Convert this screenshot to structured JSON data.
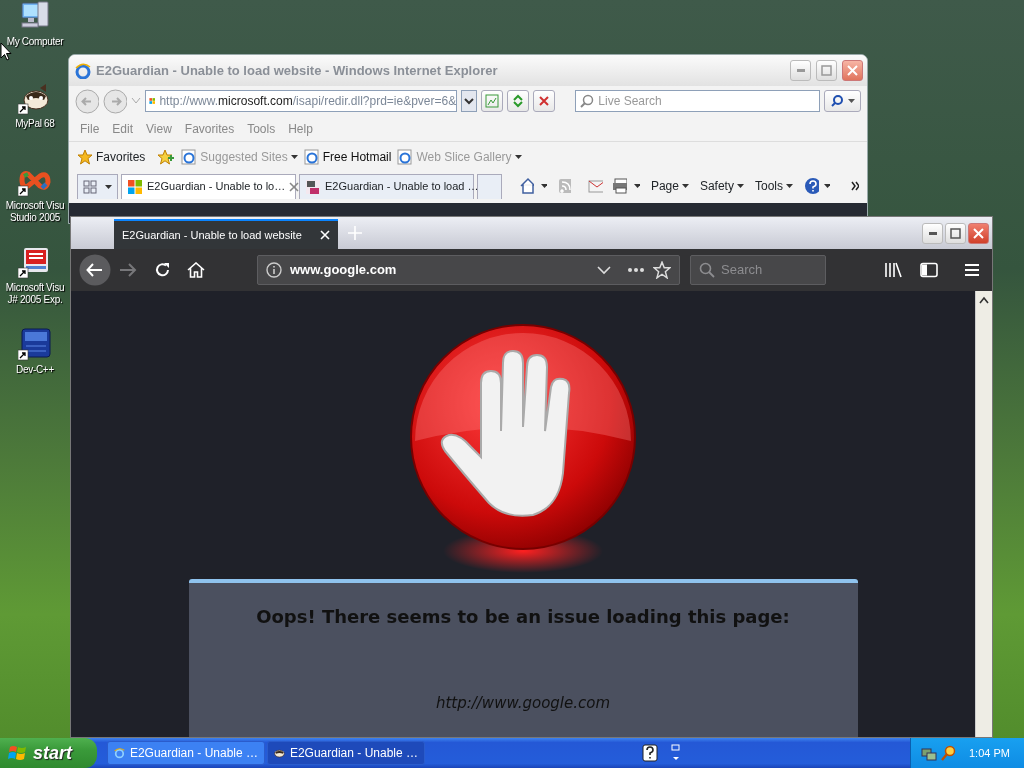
{
  "desktop_icons": [
    {
      "kind": "computer",
      "shortcut": false,
      "lines": [
        "My Computer"
      ]
    },
    {
      "kind": "raccoon",
      "shortcut": true,
      "lines": [
        "MyPal 68"
      ]
    },
    {
      "kind": "studio",
      "shortcut": true,
      "lines": [
        "Microsoft Visu",
        "Studio 2005"
      ]
    },
    {
      "kind": "jsharp",
      "shortcut": true,
      "lines": [
        "Microsoft Visu",
        "J# 2005 Exp."
      ]
    },
    {
      "kind": "devcpp",
      "shortcut": true,
      "lines": [
        "Dev-C++"
      ]
    }
  ],
  "ie_window": {
    "title": "E2Guardian - Unable to load website - Windows Internet Explorer",
    "address": {
      "prefix": "http://www.",
      "domain": "microsoft.com",
      "rest": "/isapi/redir.dll?prd=ie&pver=6&"
    },
    "search_placeholder": "Live Search",
    "menu": [
      "File",
      "Edit",
      "View",
      "Favorites",
      "Tools",
      "Help"
    ],
    "favorites_label": "Favorites",
    "favorites_bar": [
      {
        "label": "Suggested Sites",
        "disabled": true,
        "dropdown": true
      },
      {
        "label": "Free Hotmail",
        "disabled": false,
        "dropdown": false
      },
      {
        "label": "Web Slice Gallery",
        "disabled": true,
        "dropdown": true
      }
    ],
    "tabs": [
      {
        "label": "E2Guardian - Unable to lo…",
        "selected": true,
        "kind": "windows"
      },
      {
        "label": "E2Guardian - Unable to load …",
        "selected": false,
        "kind": "msdn"
      }
    ],
    "command_bar": [
      "Page",
      "Safety",
      "Tools"
    ]
  },
  "firefox_window": {
    "tab_title": "E2Guardian - Unable to load website",
    "url": "www.google.com",
    "search_placeholder": "Search",
    "page": {
      "heading": "Oops! There seems to be an issue loading this page:",
      "blocked_url": "http://www.google.com"
    }
  },
  "taskbar": {
    "start_label": "start",
    "tasks": [
      {
        "label": "E2Guardian - Unable …",
        "selected": false,
        "kind": "ie"
      },
      {
        "label": "E2Guardian - Unable …",
        "selected": true,
        "kind": "mypal"
      }
    ],
    "clock": "1:04 PM"
  }
}
